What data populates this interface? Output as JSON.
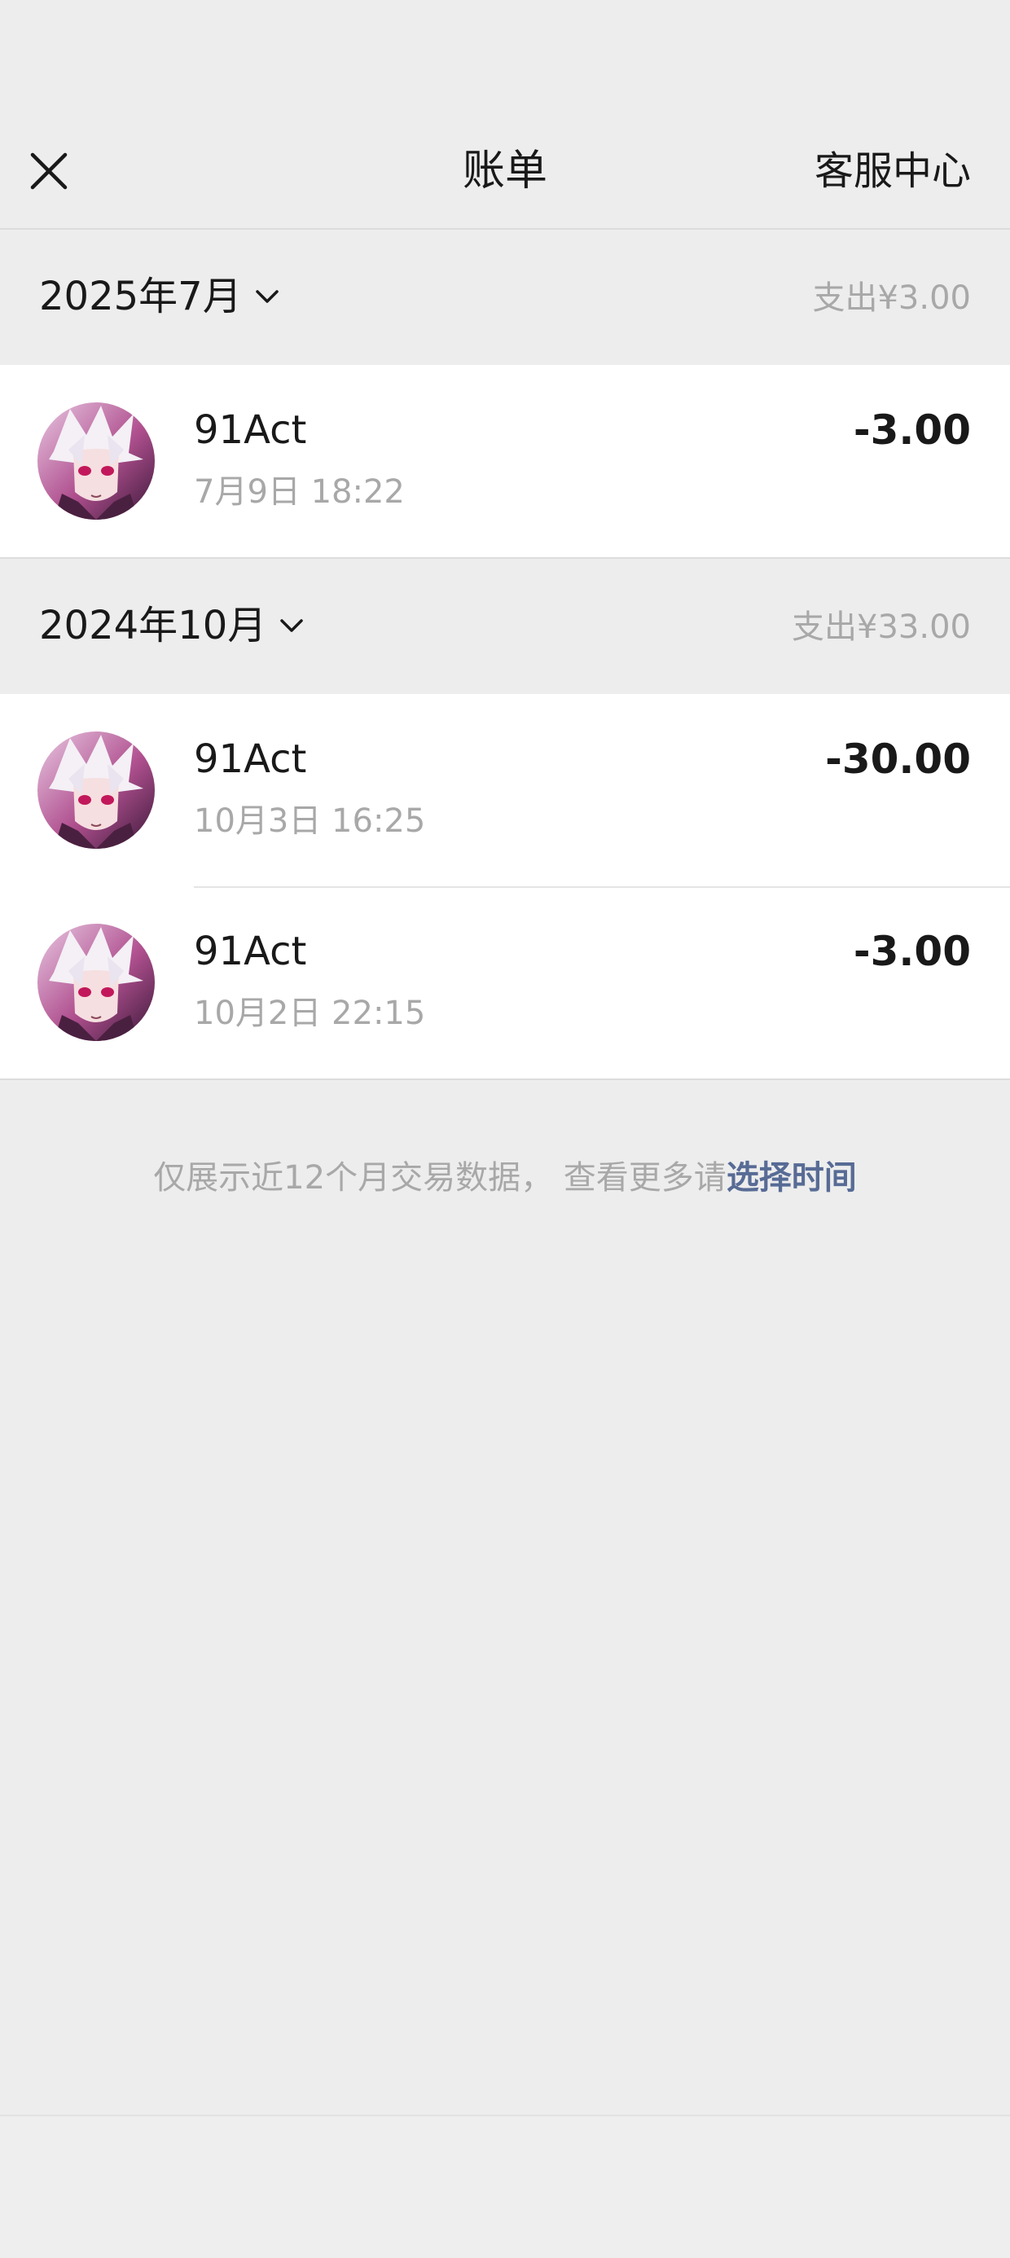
{
  "nav": {
    "title": "账单",
    "action_label": "客服中心"
  },
  "groups": [
    {
      "month_label": "2025年7月",
      "summary": "支出¥3.00",
      "transactions": [
        {
          "name": "91Act",
          "time": "7月9日 18:22",
          "amount": "-3.00"
        }
      ]
    },
    {
      "month_label": "2024年10月",
      "summary": "支出¥33.00",
      "transactions": [
        {
          "name": "91Act",
          "time": "10月3日 16:25",
          "amount": "-30.00"
        },
        {
          "name": "91Act",
          "time": "10月2日 22:15",
          "amount": "-3.00"
        }
      ]
    }
  ],
  "footer": {
    "note": "仅展示近12个月交易数据， 查看更多请",
    "link_label": "选择时间"
  },
  "colors": {
    "background": "#ededed",
    "card": "#ffffff",
    "primary_text": "#191919",
    "secondary_text": "#a8a8a8",
    "link": "#576b95"
  },
  "icons": {
    "close": "close-icon",
    "chevron": "chevron-down-icon",
    "avatar": "anime-character-avatar"
  }
}
